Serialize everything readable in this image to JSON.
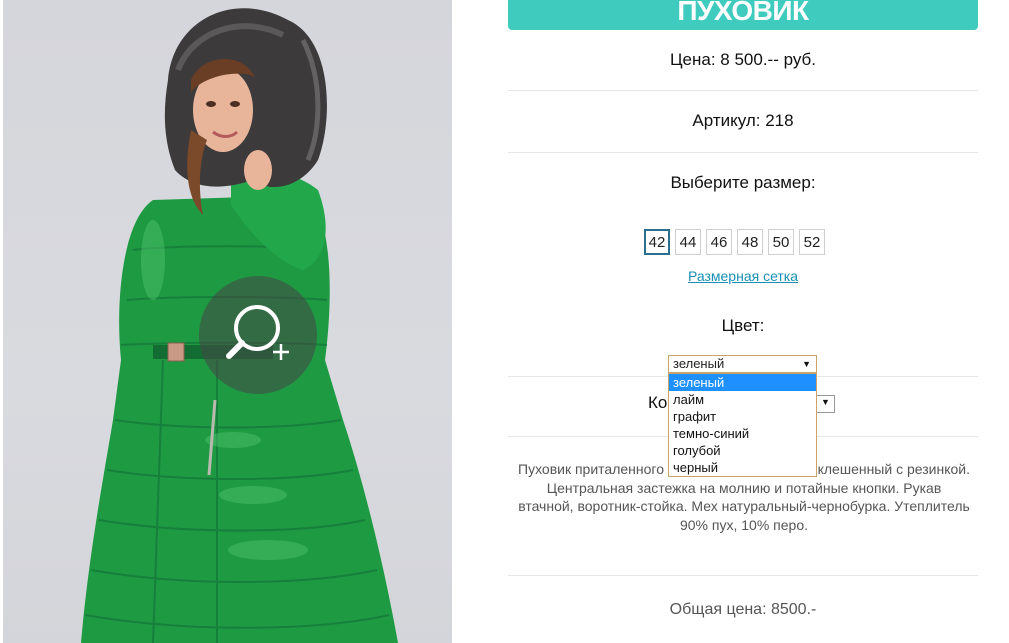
{
  "product": {
    "title": "ПУХОВИК",
    "price": "Цена: 8 500.-- руб.",
    "article": "Артикул: 218",
    "choose_size_label": "Выберите размер:",
    "sizes": [
      "42",
      "44",
      "46",
      "48",
      "50",
      "52"
    ],
    "selected_size": "42",
    "size_chart_link": "Размерная сетка",
    "color_label": "Цвет:",
    "color_selected": "зеленый",
    "color_options": [
      "зеленый",
      "лайм",
      "графит",
      "темно-синий",
      "голубой",
      "черный"
    ],
    "quantity_label_visible": "Ко",
    "description_line1_left": "Пуховик приталенного",
    "description_line1_right": "клешенный с резинкой.",
    "description_rest": "Центральная застежка на молнию и потайные кнопки. Рукав втачной, воротник-стойка. Мех натуральный-чернобурка. Утеплитель 90% пух, 10% перо.",
    "total_price": "Общая цена: 8500.-"
  },
  "icons": {
    "zoom": "zoom-in-icon",
    "select_arrow": "dropdown-arrow-icon"
  },
  "colors": {
    "accent": "#3fcbbd",
    "link": "#1a8fb5",
    "selected_option": "#1e90ff",
    "jacket": "#1e9a43"
  }
}
